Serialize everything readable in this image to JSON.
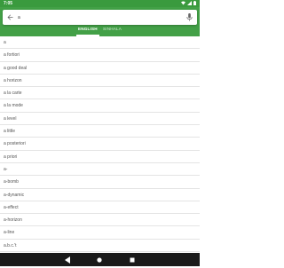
{
  "status_bar": {
    "time": "7:05"
  },
  "search": {
    "value": "a",
    "placeholder": ""
  },
  "tabs": [
    {
      "label": "ENGLISH",
      "active": true
    },
    {
      "label": "SINHALA",
      "active": false
    }
  ],
  "words": [
    "a",
    "a fortiori",
    "a good deal",
    "a horizon",
    "a la carte",
    "a la mode",
    "a level",
    "a little",
    "a posteriori",
    "a priori",
    "a-",
    "a-bomb",
    "a-dynamic",
    "a-effect",
    "a-horizon",
    "a-line",
    "a.b.c.'t"
  ],
  "colors": {
    "primary": "#43a047",
    "status": "#3a9a3e",
    "nav": "#1a1a1a"
  },
  "icons": {
    "back": "arrow-left-icon",
    "mic": "microphone-icon",
    "nav_back": "triangle-back-icon",
    "nav_home": "circle-home-icon",
    "nav_recents": "square-recents-icon"
  }
}
